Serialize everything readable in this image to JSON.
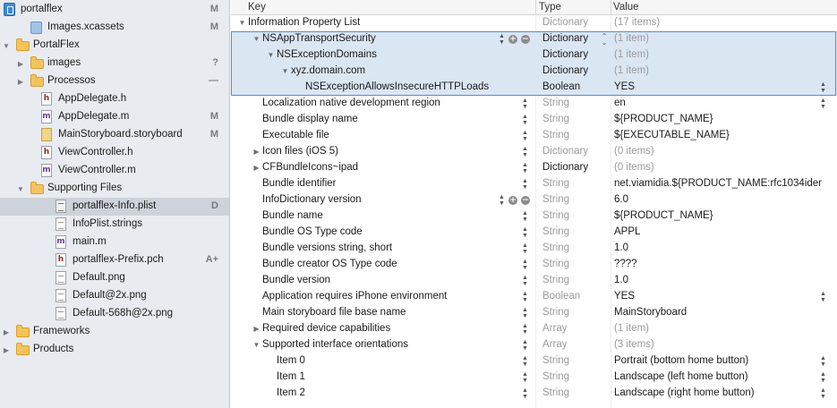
{
  "navigator": {
    "items": [
      {
        "label": "portalflex",
        "badge": "M",
        "icon": "project-icon",
        "disclosure": "open"
      },
      {
        "label": "Images.xcassets",
        "badge": "M",
        "icon": "asset-catalog-icon",
        "disclosure": ""
      },
      {
        "label": "PortalFlex",
        "badge": "",
        "icon": "folder-icon",
        "disclosure": "open"
      },
      {
        "label": "images",
        "badge": "?",
        "icon": "folder-icon",
        "disclosure": "closed"
      },
      {
        "label": "Processos",
        "badge": "—",
        "icon": "folder-icon",
        "disclosure": "closed"
      },
      {
        "label": "AppDelegate.h",
        "badge": "",
        "icon": "header-file-icon",
        "disclosure": ""
      },
      {
        "label": "AppDelegate.m",
        "badge": "M",
        "icon": "objc-file-icon",
        "disclosure": ""
      },
      {
        "label": "MainStoryboard.storyboard",
        "badge": "M",
        "icon": "storyboard-file-icon",
        "disclosure": ""
      },
      {
        "label": "ViewController.h",
        "badge": "",
        "icon": "header-file-icon",
        "disclosure": ""
      },
      {
        "label": "ViewController.m",
        "badge": "",
        "icon": "objc-file-icon",
        "disclosure": ""
      },
      {
        "label": "Supporting Files",
        "badge": "",
        "icon": "folder-icon",
        "disclosure": "open"
      },
      {
        "label": "portalflex-Info.plist",
        "badge": "D",
        "icon": "plist-file-icon",
        "disclosure": ""
      },
      {
        "label": "InfoPlist.strings",
        "badge": "",
        "icon": "strings-file-icon",
        "disclosure": ""
      },
      {
        "label": "main.m",
        "badge": "",
        "icon": "objc-file-icon",
        "disclosure": ""
      },
      {
        "label": "portalflex-Prefix.pch",
        "badge": "A+",
        "icon": "header-file-icon",
        "disclosure": ""
      },
      {
        "label": "Default.png",
        "badge": "",
        "icon": "image-file-icon",
        "disclosure": ""
      },
      {
        "label": "Default@2x.png",
        "badge": "",
        "icon": "image-file-icon",
        "disclosure": ""
      },
      {
        "label": "Default-568h@2x.png",
        "badge": "",
        "icon": "image-file-icon",
        "disclosure": ""
      },
      {
        "label": "Frameworks",
        "badge": "",
        "icon": "folder-icon",
        "disclosure": "closed"
      },
      {
        "label": "Products",
        "badge": "",
        "icon": "folder-icon",
        "disclosure": "closed"
      }
    ]
  },
  "editor": {
    "headers": {
      "key": "Key",
      "type": "Type",
      "value": "Value"
    },
    "rows": [
      {
        "key": "Information Property List",
        "type": "Dictionary",
        "value": "(17 items)",
        "disclosure": "open",
        "type_dim": true,
        "value_dim": true
      },
      {
        "key": "NSAppTransportSecurity",
        "type": "Dictionary",
        "value": "(1 item)",
        "disclosure": "open",
        "type_dim": false,
        "value_dim": true
      },
      {
        "key": "NSExceptionDomains",
        "type": "Dictionary",
        "value": "(1 item)",
        "disclosure": "open",
        "type_dim": false,
        "value_dim": true
      },
      {
        "key": "xyz.domain.com",
        "type": "Dictionary",
        "value": "(1 item)",
        "disclosure": "open",
        "type_dim": false,
        "value_dim": true
      },
      {
        "key": "NSExceptionAllowsInsecureHTTPLoads",
        "type": "Boolean",
        "value": "YES",
        "disclosure": "",
        "type_dim": false,
        "value_dim": false
      },
      {
        "key": "Localization native development region",
        "type": "String",
        "value": "en",
        "disclosure": "",
        "type_dim": true,
        "value_dim": false
      },
      {
        "key": "Bundle display name",
        "type": "String",
        "value": "${PRODUCT_NAME}",
        "disclosure": "",
        "type_dim": true,
        "value_dim": false
      },
      {
        "key": "Executable file",
        "type": "String",
        "value": "${EXECUTABLE_NAME}",
        "disclosure": "",
        "type_dim": true,
        "value_dim": false
      },
      {
        "key": "Icon files (iOS 5)",
        "type": "Dictionary",
        "value": "(0 items)",
        "disclosure": "closed",
        "type_dim": true,
        "value_dim": true
      },
      {
        "key": "CFBundleIcons~ipad",
        "type": "Dictionary",
        "value": "(0 items)",
        "disclosure": "closed",
        "type_dim": false,
        "value_dim": true
      },
      {
        "key": "Bundle identifier",
        "type": "String",
        "value": "net.viamidia.${PRODUCT_NAME:rfc1034identi",
        "disclosure": "",
        "type_dim": true,
        "value_dim": false
      },
      {
        "key": "InfoDictionary version",
        "type": "String",
        "value": "6.0",
        "disclosure": "",
        "type_dim": true,
        "value_dim": false
      },
      {
        "key": "Bundle name",
        "type": "String",
        "value": "${PRODUCT_NAME}",
        "disclosure": "",
        "type_dim": true,
        "value_dim": false
      },
      {
        "key": "Bundle OS Type code",
        "type": "String",
        "value": "APPL",
        "disclosure": "",
        "type_dim": true,
        "value_dim": false
      },
      {
        "key": "Bundle versions string, short",
        "type": "String",
        "value": "1.0",
        "disclosure": "",
        "type_dim": true,
        "value_dim": false
      },
      {
        "key": "Bundle creator OS Type code",
        "type": "String",
        "value": "????",
        "disclosure": "",
        "type_dim": true,
        "value_dim": false
      },
      {
        "key": "Bundle version",
        "type": "String",
        "value": "1.0",
        "disclosure": "",
        "type_dim": true,
        "value_dim": false
      },
      {
        "key": "Application requires iPhone environment",
        "type": "Boolean",
        "value": "YES",
        "disclosure": "",
        "type_dim": true,
        "value_dim": false
      },
      {
        "key": "Main storyboard file base name",
        "type": "String",
        "value": "MainStoryboard",
        "disclosure": "",
        "type_dim": true,
        "value_dim": false
      },
      {
        "key": "Required device capabilities",
        "type": "Array",
        "value": "(1 item)",
        "disclosure": "closed",
        "type_dim": true,
        "value_dim": true
      },
      {
        "key": "Supported interface orientations",
        "type": "Array",
        "value": "(3 items)",
        "disclosure": "open",
        "type_dim": true,
        "value_dim": true
      },
      {
        "key": "Item 0",
        "type": "String",
        "value": "Portrait (bottom home button)",
        "disclosure": "",
        "type_dim": true,
        "value_dim": false
      },
      {
        "key": "Item 1",
        "type": "String",
        "value": "Landscape (left home button)",
        "disclosure": "",
        "type_dim": true,
        "value_dim": false
      },
      {
        "key": "Item 2",
        "type": "String",
        "value": "Landscape (right home button)",
        "disclosure": "",
        "type_dim": true,
        "value_dim": false
      }
    ]
  }
}
